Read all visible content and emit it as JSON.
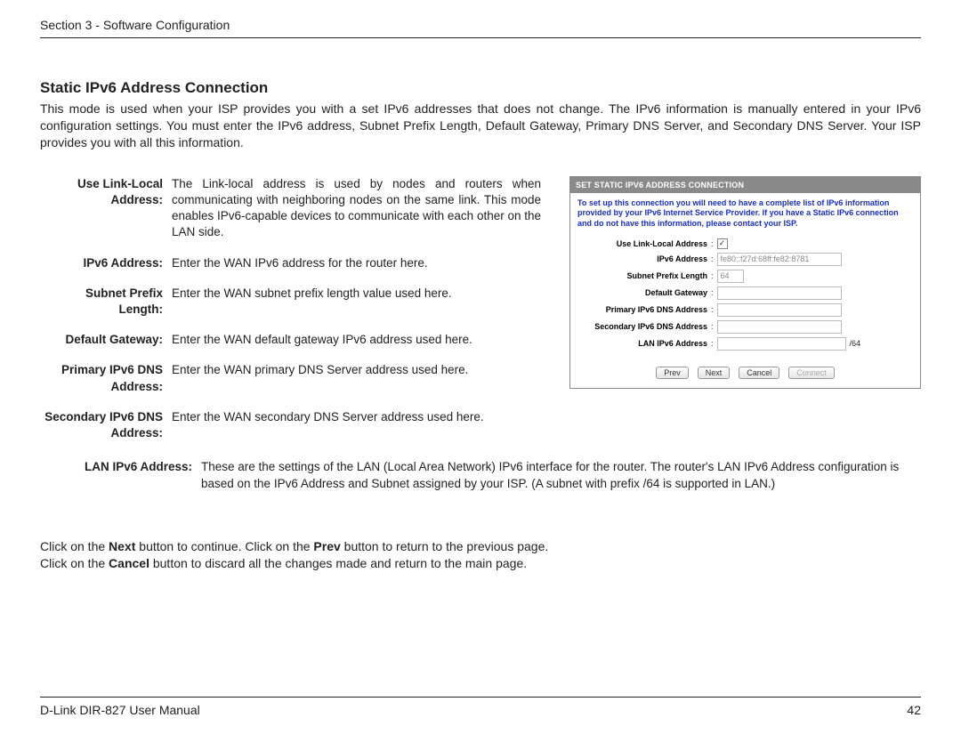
{
  "header": {
    "section": "Section 3 - Software Configuration"
  },
  "title": "Static IPv6 Address Connection",
  "intro": "This mode is used when your ISP provides you with a set IPv6 addresses that does not change. The IPv6 information is manually entered in your IPv6 configuration settings. You must enter the IPv6 address, Subnet Prefix Length, Default Gateway, Primary DNS Server, and Secondary DNS Server. Your ISP provides you with all this information.",
  "defs": [
    {
      "term1": "Use Link-Local",
      "term2": "Address:",
      "desc": "The Link-local address is used by nodes and routers when communicating with neighboring nodes on the same link. This mode enables IPv6-capable devices to communicate with each other on the LAN side."
    },
    {
      "term1": "IPv6 Address:",
      "term2": "",
      "desc": "Enter the WAN IPv6 address for the router here."
    },
    {
      "term1": "Subnet Prefix",
      "term2": "Length:",
      "desc": "Enter the WAN subnet prefix length value used here."
    },
    {
      "term1": "Default Gateway:",
      "term2": "",
      "desc": "Enter the WAN default gateway IPv6 address used here."
    },
    {
      "term1": "Primary IPv6 DNS",
      "term2": "Address:",
      "desc": "Enter the WAN primary DNS Server address used here."
    },
    {
      "term1": "Secondary IPv6 DNS",
      "term2": "Address:",
      "desc": "Enter the WAN secondary DNS Server address used here."
    },
    {
      "term1": "LAN IPv6 Address:",
      "term2": "",
      "desc": "These are the settings of the LAN (Local Area Network) IPv6 interface for the router. The router's LAN IPv6 Address configuration is based on the IPv6 Address and Subnet assigned by your ISP. (A subnet with prefix /64 is supported in LAN.)"
    }
  ],
  "screenshot": {
    "title": "SET STATIC IPV6 ADDRESS CONNECTION",
    "note": "To set up this connection you will need to have a complete list of IPv6 information provided by your IPv6 Internet Service Provider. If you have a Static IPv6 connection and do not have this information, please contact your ISP.",
    "rows": {
      "useLinkLocalLabel": "Use Link-Local Address",
      "ipv6AddrLabel": "IPv6 Address",
      "ipv6AddrValue": "fe80::f27d:68ff:fe82:8781",
      "subnetLabel": "Subnet Prefix Length",
      "subnetValue": "64",
      "gatewayLabel": "Default Gateway",
      "primaryDnsLabel": "Primary IPv6 DNS Address",
      "secondaryDnsLabel": "Secondary IPv6 DNS Address",
      "lanIpv6Label": "LAN IPv6 Address",
      "lanSuffix": "/64"
    },
    "buttons": {
      "prev": "Prev",
      "next": "Next",
      "cancel": "Cancel",
      "connect": "Connect"
    },
    "checkmark": "✓"
  },
  "after": {
    "l1a": "Click on the ",
    "l1b": "Next",
    "l1c": " button to continue. Click on the ",
    "l1d": "Prev",
    "l1e": " button to return to the previous page.",
    "l2a": "Click on the ",
    "l2b": "Cancel",
    "l2c": " button to discard all the changes made and return to the main page."
  },
  "footer": {
    "left": "D-Link DIR-827 User Manual",
    "page": "42"
  }
}
